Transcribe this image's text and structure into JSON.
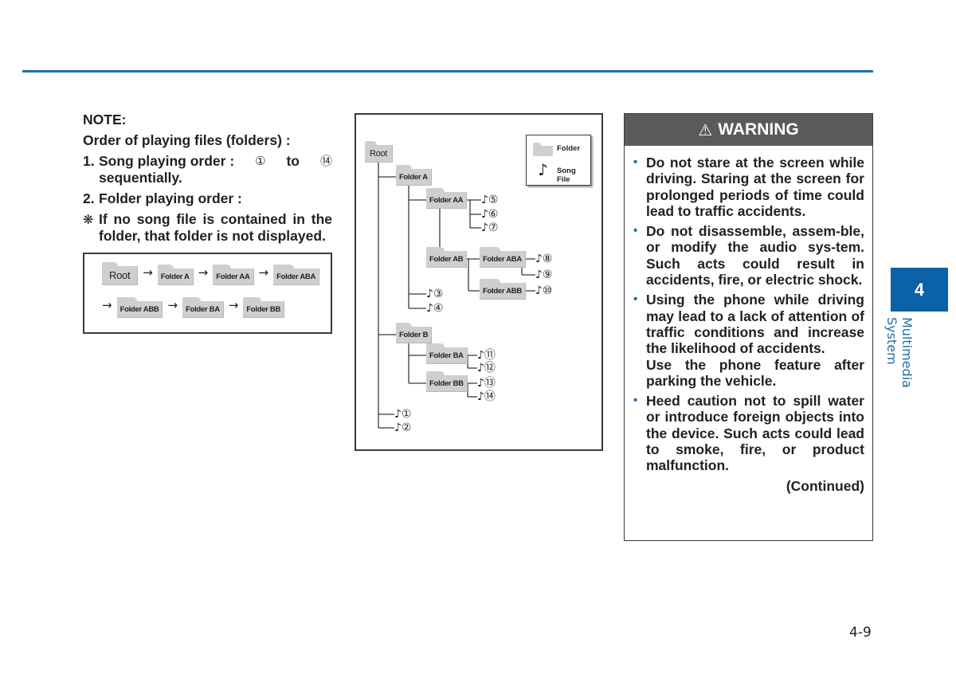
{
  "colors": {
    "accent": "#1f6fa6",
    "tab": "#0c62a6",
    "warning_header": "#5a5a5a",
    "folder": "#cfcfcf"
  },
  "note": {
    "title": "NOTE:",
    "subtitle": "Order of playing files (folders) :",
    "items": [
      {
        "num": "1.",
        "text_a": "Song playing order :",
        "from": "①",
        "to_word": "to",
        "to": "⑭",
        "text_b": "sequentially."
      },
      {
        "num": "2.",
        "text": "Folder playing order :"
      }
    ],
    "remark_symbol": "❋",
    "remark": "If no song file is contained in the folder, that folder is not displayed."
  },
  "folder_order": {
    "row1": [
      "Root",
      "Folder A",
      "Folder AA",
      "Folder ABA"
    ],
    "row2": [
      "Folder ABB",
      "Folder BA",
      "Folder BB"
    ],
    "arrow": "→"
  },
  "tree": {
    "legend": {
      "folder_label": "Folder",
      "song_label": "Song File",
      "song_icon": "♪"
    },
    "folders": {
      "root": "Root",
      "a": "Folder A",
      "aa": "Folder AA",
      "ab": "Folder AB",
      "aba": "Folder ABA",
      "abb": "Folder ABB",
      "b": "Folder B",
      "ba": "Folder BA",
      "bb": "Folder BB"
    },
    "songs": {
      "s1": "♪①",
      "s2": "♪②",
      "s3": "♪③",
      "s4": "♪④",
      "s5": "♪⑤",
      "s6": "♪⑥",
      "s7": "♪⑦",
      "s8": "♪⑧",
      "s9": "♪⑨",
      "s10": "♪⑩",
      "s11": "♪⑪",
      "s12": "♪⑫",
      "s13": "♪⑬",
      "s14": "♪⑭"
    }
  },
  "warning": {
    "icon": "⚠",
    "title": "WARNING",
    "bullet_icon": "•",
    "bullets": [
      {
        "p1": "Do not stare at the screen while driving. Staring at the screen for prolonged periods of time could lead to traffic accidents."
      },
      {
        "p1": "Do not disassemble, assem-ble, or modify the audio sys-tem. Such acts could result in accidents, fire, or electric shock."
      },
      {
        "p1": "Using the phone while driving may lead to a lack of attention of traffic conditions and increase the likelihood of accidents.",
        "p2": "Use the phone feature after parking the vehicle."
      },
      {
        "p1": "Heed caution not to spill water or introduce foreign objects into the device. Such acts could lead to smoke, fire, or product malfunction."
      }
    ],
    "continued": "(Continued)"
  },
  "side_tab": {
    "chapter": "4",
    "label": "Multimedia System"
  },
  "page_number": "4-9"
}
